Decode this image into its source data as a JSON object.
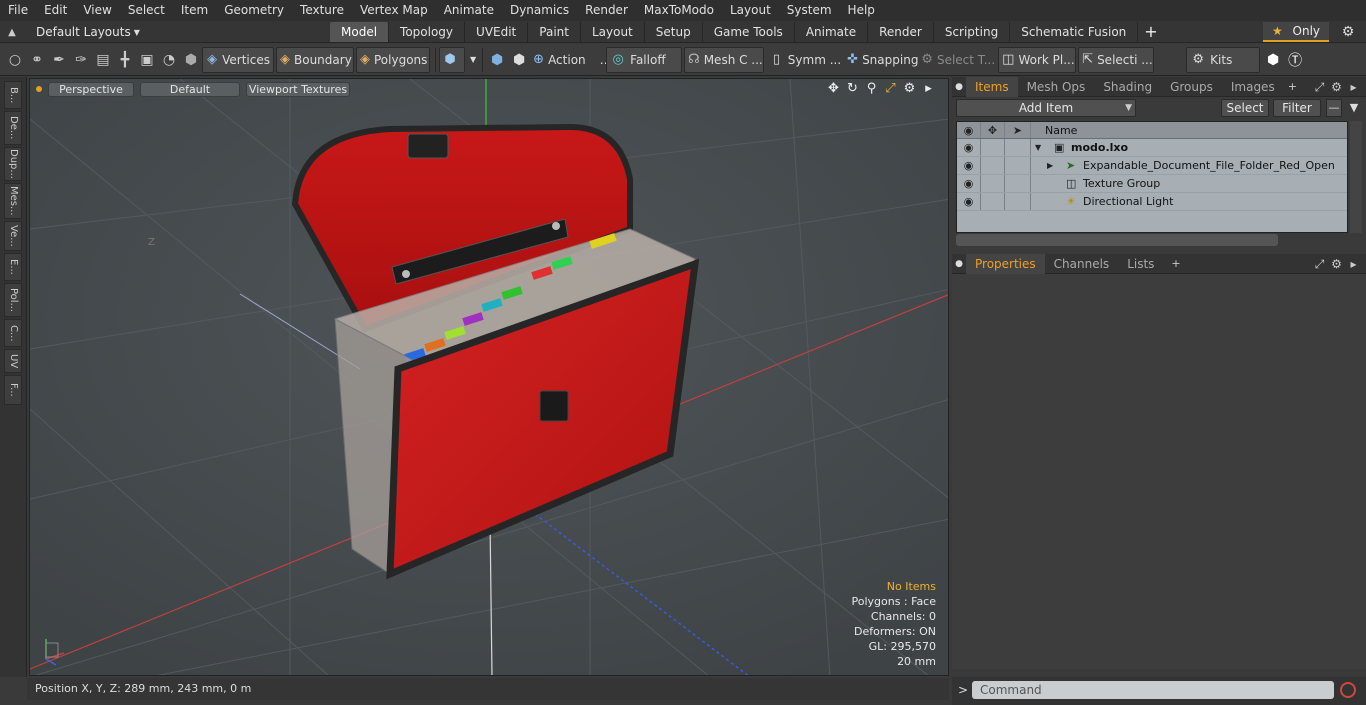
{
  "menubar": {
    "items": [
      "File",
      "Edit",
      "View",
      "Select",
      "Item",
      "Geometry",
      "Texture",
      "Vertex Map",
      "Animate",
      "Dynamics",
      "Render",
      "MaxToModo",
      "Layout",
      "System",
      "Help"
    ]
  },
  "layoutbar": {
    "layout_label": "Default Layouts",
    "tabs": [
      "Model",
      "Topology",
      "UVEdit",
      "Paint",
      "Layout",
      "Setup",
      "Game Tools",
      "Animate",
      "Render",
      "Scripting",
      "Schematic Fusion"
    ],
    "active_tab": "Model",
    "only_label": "Only"
  },
  "toolbar": {
    "vertices": "Vertices",
    "boundary": "Boundary",
    "polygons": "Polygons",
    "action": "Action",
    "falloff": "Falloff",
    "mesh": "Mesh C ...",
    "symm": "Symm ...",
    "snapping": "Snapping",
    "select_t": "Select T...",
    "work_pl": "Work Pl...",
    "selecti": "Selecti ...",
    "kits": "Kits"
  },
  "sidebar": {
    "tabs": [
      "B...",
      "De...",
      "Dup...",
      "Mes...",
      "Ve...",
      "E...",
      "Pol...",
      "C...",
      "UV",
      "F..."
    ]
  },
  "viewport": {
    "view": "Perspective",
    "shading": "Default",
    "textures": "Viewport Textures",
    "axis_z_label": "Z",
    "hud": {
      "selection": "No Items",
      "polygons": "Polygons : Face",
      "channels": "Channels: 0",
      "deformers": "Deformers: ON",
      "gl": "GL: 295,570",
      "scale": "20 mm"
    }
  },
  "status": {
    "position": "Position X, Y, Z:   289 mm, 243 mm, 0 m"
  },
  "items_panel": {
    "tabs": [
      "Items",
      "Mesh Ops",
      "Shading",
      "Groups",
      "Images"
    ],
    "active_tab": "Items",
    "add_item": "Add Item",
    "select": "Select",
    "filter": "Filter",
    "name_header": "Name",
    "rows": [
      {
        "name": "modo.lxo"
      },
      {
        "name": "Expandable_Document_File_Folder_Red_Open"
      },
      {
        "name": "Texture Group"
      },
      {
        "name": "Directional Light"
      }
    ]
  },
  "props_panel": {
    "tabs": [
      "Properties",
      "Channels",
      "Lists"
    ],
    "active_tab": "Properties"
  },
  "command": {
    "placeholder": "Command",
    "prompt": ">"
  },
  "colors": {
    "accent": "#f0a020",
    "folder_red": "#cc1a1a",
    "axis_x": "#d03a3a",
    "axis_y": "#3ad03a",
    "axis_z": "#3a5ae0"
  }
}
